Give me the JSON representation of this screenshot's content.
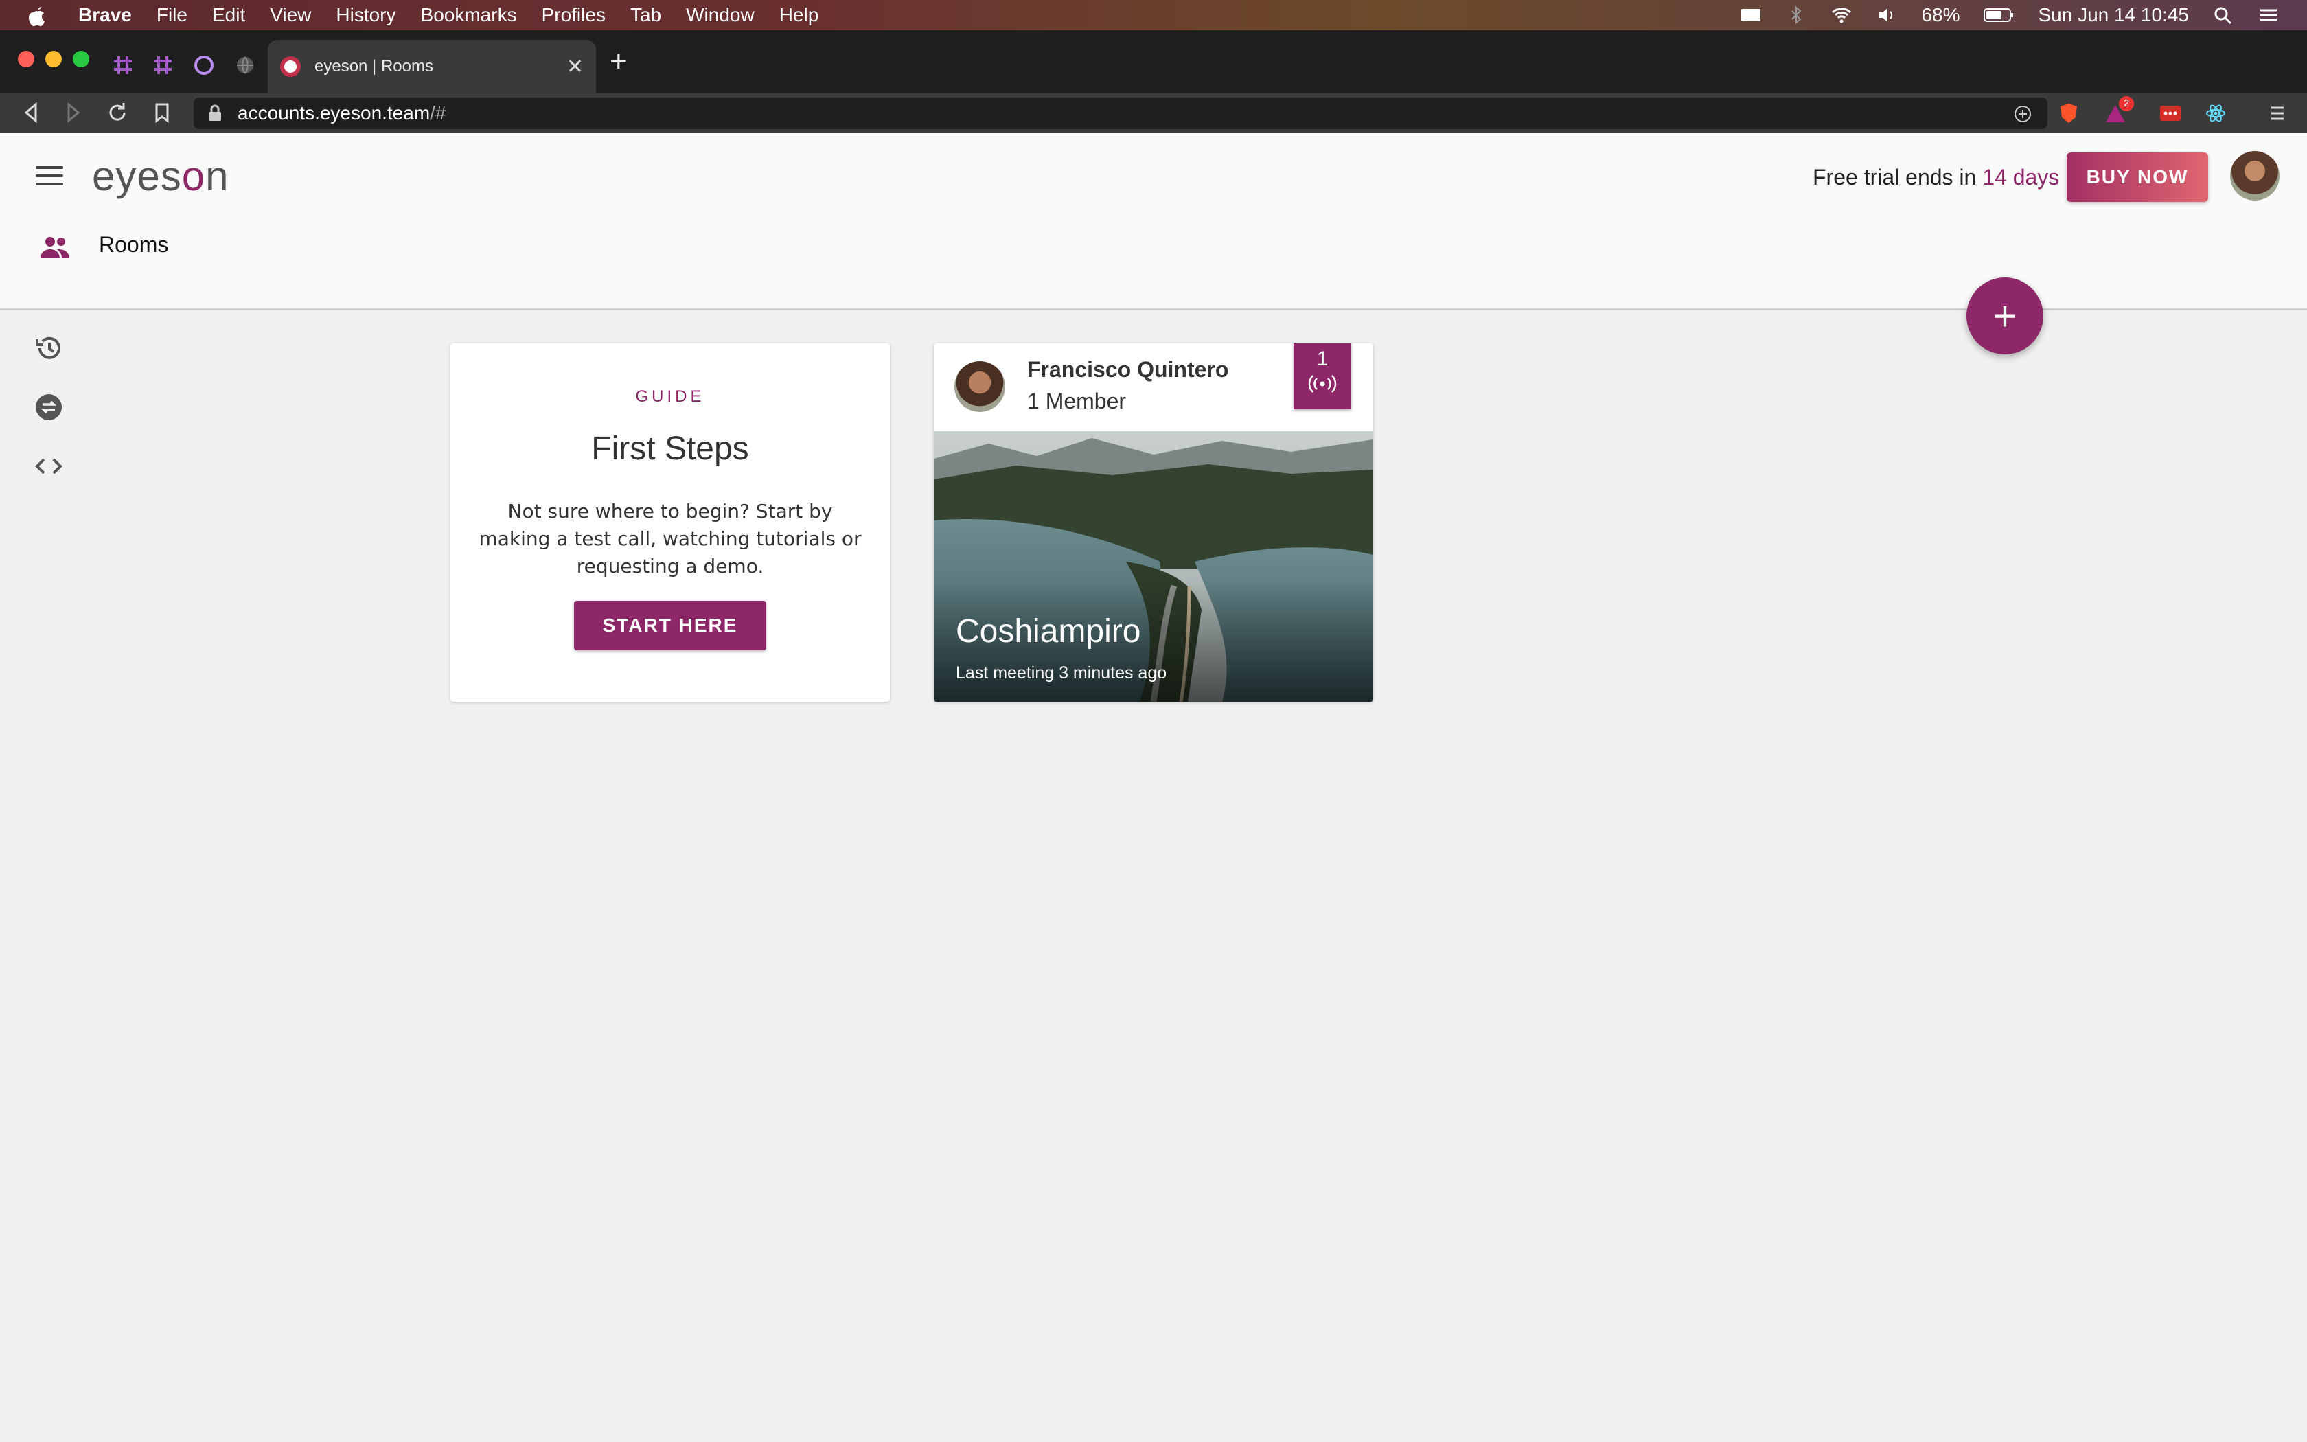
{
  "menubar": {
    "app": "Brave",
    "items": [
      "File",
      "Edit",
      "View",
      "History",
      "Bookmarks",
      "Profiles",
      "Tab",
      "Window",
      "Help"
    ],
    "battery": "68%",
    "datetime": "Sun Jun 14  10:45"
  },
  "browser": {
    "tab_title": "eyeson | Rooms",
    "url_host": "accounts.eyeson.team",
    "url_path": "/#",
    "ext_badge": "2"
  },
  "header": {
    "logo_pre": "eyes",
    "logo_o": "o",
    "logo_post": "n",
    "trial_text": "Free trial ends in ",
    "trial_days": "14 days",
    "buy_label": "BUY NOW"
  },
  "nav": {
    "rooms_label": "Rooms"
  },
  "guide_card": {
    "overline": "GUIDE",
    "title": "First Steps",
    "description": "Not sure where to begin? Start by making a test call, watching tutorials or requesting a demo.",
    "button": "START HERE"
  },
  "room_card": {
    "owner": "Francisco Quintero",
    "members": "1 Member",
    "live_count": "1",
    "room_name": "Coshiampiro",
    "last_meeting": "Last meeting 3 minutes ago"
  },
  "colors": {
    "accent": "#8d2768",
    "background": "#f0f0f0"
  }
}
